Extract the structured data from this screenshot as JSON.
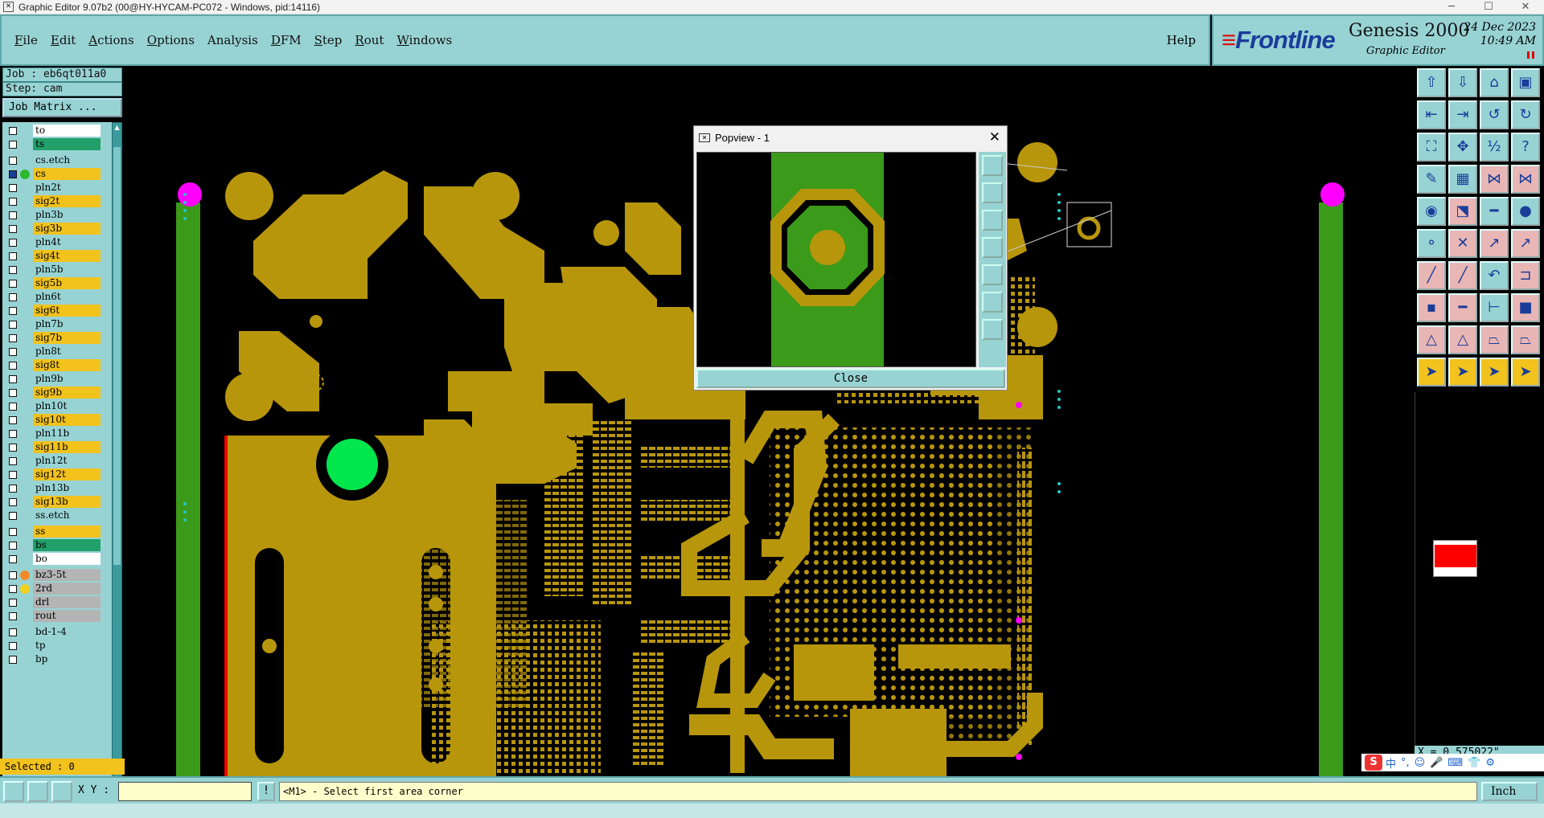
{
  "window": {
    "title": "Graphic Editor 9.07b2 (00@HY-HYCAM-PC072 - Windows, pid:14116)",
    "minimize": "─",
    "maximize": "☐",
    "close": "✕"
  },
  "menubar": {
    "items": [
      {
        "key": "F",
        "rest": "ile"
      },
      {
        "key": "E",
        "rest": "dit"
      },
      {
        "key": "A",
        "rest": "ctions"
      },
      {
        "key": "O",
        "rest": "ptions"
      },
      {
        "key": "",
        "rest": "Analysis"
      },
      {
        "key": "D",
        "rest": "FM"
      },
      {
        "key": "S",
        "rest": "tep"
      },
      {
        "key": "R",
        "rest": "out"
      },
      {
        "key": "W",
        "rest": "indows"
      }
    ],
    "help": "Help"
  },
  "brand": {
    "logo": "Frontline",
    "product": "Genesis 2000",
    "subtitle": "Graphic Editor",
    "date": "24 Dec 2023",
    "time": "10:49 AM"
  },
  "job": {
    "job_label": "Job : eb6qt011a0",
    "step_label": "Step: cam",
    "matrix_button": "Job Matrix ..."
  },
  "layers": [
    {
      "name": "to",
      "color": "#ffffff"
    },
    {
      "name": "ts",
      "color": "#22a06a"
    },
    {
      "name": "cs.etch",
      "color": "#98d3d4",
      "gap": true
    },
    {
      "name": "cs",
      "color": "#f2c21d",
      "dot": "#2db82d",
      "active": true
    },
    {
      "name": "pln2t",
      "color": "#98d3d4"
    },
    {
      "name": "sig2t",
      "color": "#f2c21d"
    },
    {
      "name": "pln3b",
      "color": "#98d3d4"
    },
    {
      "name": "sig3b",
      "color": "#f2c21d"
    },
    {
      "name": "pln4t",
      "color": "#98d3d4"
    },
    {
      "name": "sig4t",
      "color": "#f2c21d"
    },
    {
      "name": "pln5b",
      "color": "#98d3d4"
    },
    {
      "name": "sig5b",
      "color": "#f2c21d"
    },
    {
      "name": "pln6t",
      "color": "#98d3d4"
    },
    {
      "name": "sig6t",
      "color": "#f2c21d"
    },
    {
      "name": "pln7b",
      "color": "#98d3d4"
    },
    {
      "name": "sig7b",
      "color": "#f2c21d"
    },
    {
      "name": "pln8t",
      "color": "#98d3d4"
    },
    {
      "name": "sig8t",
      "color": "#f2c21d"
    },
    {
      "name": "pln9b",
      "color": "#98d3d4"
    },
    {
      "name": "sig9b",
      "color": "#f2c21d"
    },
    {
      "name": "pln10t",
      "color": "#98d3d4"
    },
    {
      "name": "sig10t",
      "color": "#f2c21d"
    },
    {
      "name": "pln11b",
      "color": "#98d3d4"
    },
    {
      "name": "sig11b",
      "color": "#f2c21d"
    },
    {
      "name": "pln12t",
      "color": "#98d3d4"
    },
    {
      "name": "sig12t",
      "color": "#f2c21d"
    },
    {
      "name": "pln13b",
      "color": "#98d3d4"
    },
    {
      "name": "sig13b",
      "color": "#f2c21d"
    },
    {
      "name": "ss.etch",
      "color": "#98d3d4"
    },
    {
      "name": "ss",
      "color": "#f2c21d",
      "gap": true
    },
    {
      "name": "bs",
      "color": "#22a06a"
    },
    {
      "name": "bo",
      "color": "#ffffff"
    },
    {
      "name": "bz3-5t",
      "color": "#b4b4b4",
      "dot": "#f28a2a",
      "gap": true
    },
    {
      "name": "2rd",
      "color": "#b4b4b4",
      "dot": "#f2d21d"
    },
    {
      "name": "drl",
      "color": "#b4b4b4"
    },
    {
      "name": "rout",
      "color": "#b4b4b4"
    },
    {
      "name": "bd-1-4",
      "color": "#98d3d4",
      "gap": true
    },
    {
      "name": "tp",
      "color": "#98d3d4"
    },
    {
      "name": "bp",
      "color": "#98d3d4"
    }
  ],
  "selected": "Selected : 0",
  "popview": {
    "title": "Popview - 1",
    "close_button": "Close"
  },
  "coordinate": "X = 0.575022\"",
  "bottombar": {
    "xy_label": "X Y :",
    "xy_value": "",
    "excl": "!",
    "prompt": "<M1> - Select first area corner",
    "units": "Inch"
  },
  "ime": {
    "logo": "S",
    "lang": "中"
  },
  "colors": {
    "copper": "#b8960c",
    "board_green": "#3c9a1a",
    "pad_green": "#00e64d",
    "magenta": "#ff00ff",
    "cyan": "#22c7c7",
    "panel": "#98d3d4"
  }
}
